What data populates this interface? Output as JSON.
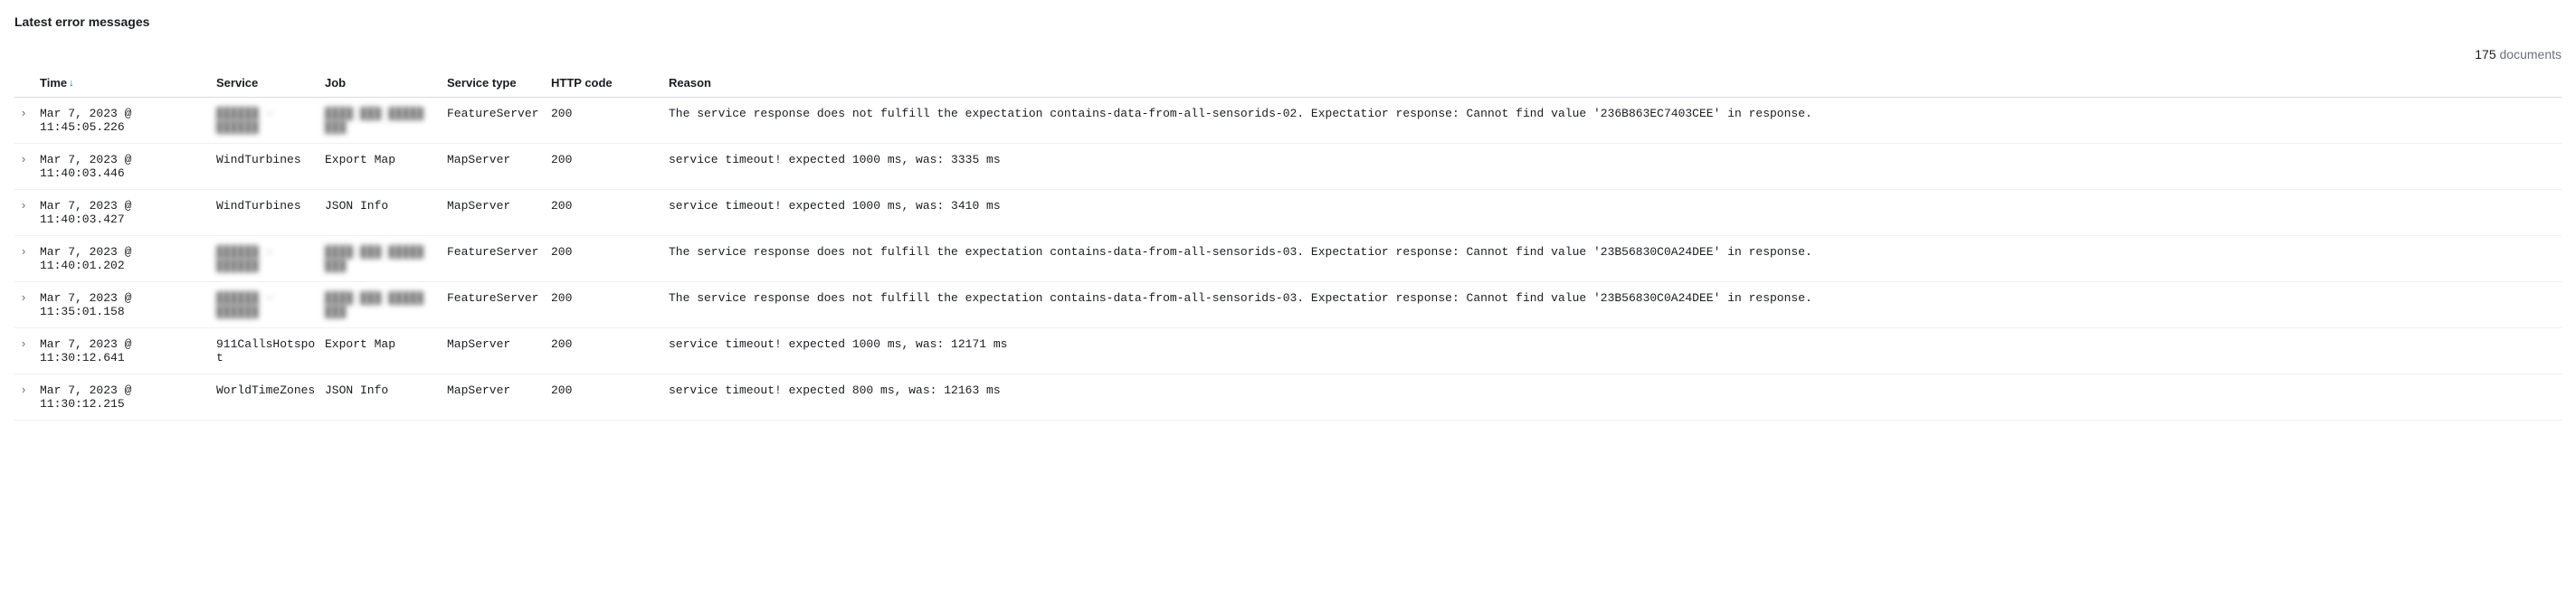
{
  "title": "Latest error messages",
  "documents_count": "175",
  "documents_label": "documents",
  "columns": {
    "time": "Time",
    "service": "Service",
    "job": "Job",
    "service_type": "Service type",
    "http_code": "HTTP code",
    "reason": "Reason"
  },
  "rows": [
    {
      "time": "Mar 7, 2023 @ 11:45:05.226",
      "service": "██████ - ██████",
      "service_blur": true,
      "job": "████ ███ █████ ███",
      "job_blur": true,
      "service_type": "FeatureServer",
      "http_code": "200",
      "reason": "The service response does not fulfill the expectation contains-data-from-all-sensorids-02. Expectatior response: Cannot find value '236B863EC7403CEE' in response."
    },
    {
      "time": "Mar 7, 2023 @ 11:40:03.446",
      "service": "WindTurbines",
      "service_blur": false,
      "job": "Export Map",
      "job_blur": false,
      "service_type": "MapServer",
      "http_code": "200",
      "reason": "service timeout! expected 1000 ms, was: 3335 ms"
    },
    {
      "time": "Mar 7, 2023 @ 11:40:03.427",
      "service": "WindTurbines",
      "service_blur": false,
      "job": "JSON Info",
      "job_blur": false,
      "service_type": "MapServer",
      "http_code": "200",
      "reason": "service timeout! expected 1000 ms, was: 3410 ms"
    },
    {
      "time": "Mar 7, 2023 @ 11:40:01.202",
      "service": "██████ - ██████",
      "service_blur": true,
      "job": "████ ███ █████ ███",
      "job_blur": true,
      "service_type": "FeatureServer",
      "http_code": "200",
      "reason": "The service response does not fulfill the expectation contains-data-from-all-sensorids-03. Expectatior response: Cannot find value '23B56830C0A24DEE' in response."
    },
    {
      "time": "Mar 7, 2023 @ 11:35:01.158",
      "service": "██████ - ██████",
      "service_blur": true,
      "job": "████ ███ █████ ███",
      "job_blur": true,
      "service_type": "FeatureServer",
      "http_code": "200",
      "reason": "The service response does not fulfill the expectation contains-data-from-all-sensorids-03. Expectatior response: Cannot find value '23B56830C0A24DEE' in response."
    },
    {
      "time": "Mar 7, 2023 @ 11:30:12.641",
      "service": "911CallsHotspot",
      "service_blur": false,
      "job": "Export Map",
      "job_blur": false,
      "service_type": "MapServer",
      "http_code": "200",
      "reason": "service timeout! expected 1000 ms, was: 12171 ms"
    },
    {
      "time": "Mar 7, 2023 @ 11:30:12.215",
      "service": "WorldTimeZones",
      "service_blur": false,
      "job": "JSON Info",
      "job_blur": false,
      "service_type": "MapServer",
      "http_code": "200",
      "reason": "service timeout! expected 800 ms, was: 12163 ms"
    }
  ]
}
